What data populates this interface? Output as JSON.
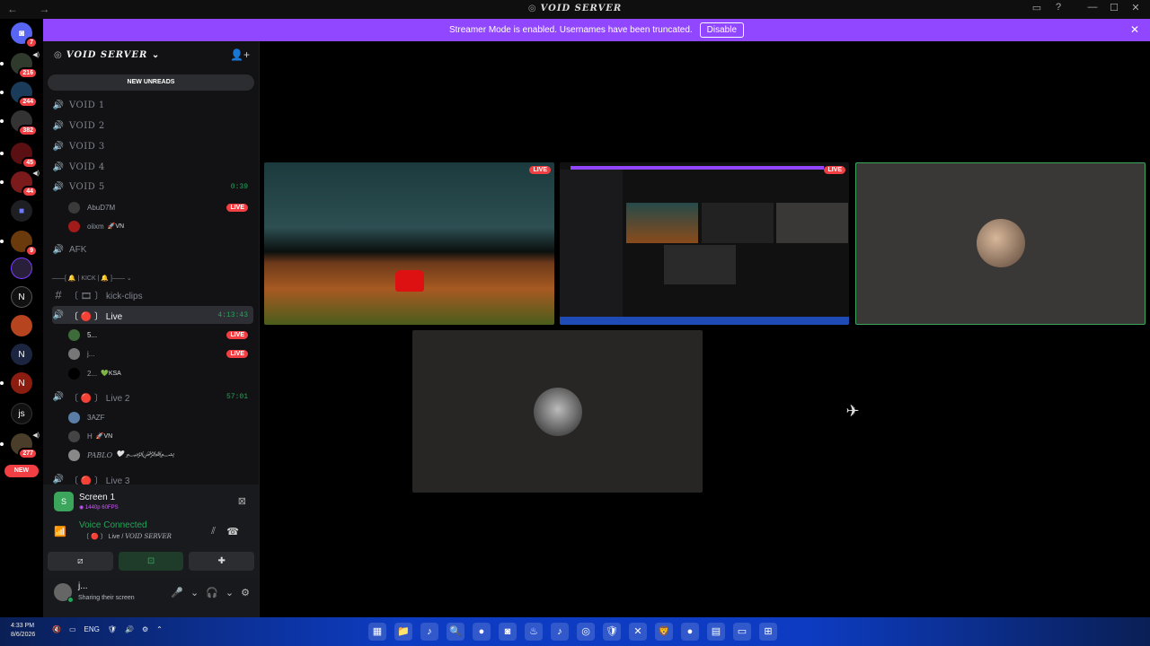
{
  "window": {
    "nav_label": "← →",
    "title": "VOID SERVER",
    "title_icon": "◎",
    "controls": [
      "▭",
      "?",
      "",
      "—",
      "☐",
      "✕"
    ]
  },
  "banner": {
    "text": "Streamer Mode is enabled. Usernames have been truncated.",
    "disable_label": "Disable",
    "close_label": "✕",
    "color": "#9146ff"
  },
  "guilds": [
    {
      "label": "◙",
      "badge": "7"
    },
    {
      "label": "•",
      "badge": "216",
      "vol": "◀)"
    },
    {
      "label": "•",
      "badge": "244"
    },
    {
      "label": "•",
      "badge": "382"
    },
    {
      "label": "•",
      "badge": "45"
    },
    {
      "label": "•",
      "badge": "44",
      "vol": "◀)"
    },
    {
      "label": "■",
      "badge": ""
    },
    {
      "label": "•",
      "badge": "9"
    },
    {
      "label": "•",
      "badge": ""
    },
    {
      "label": "N",
      "badge": ""
    },
    {
      "label": "•",
      "badge": ""
    },
    {
      "label": "N",
      "badge": ""
    },
    {
      "label": "N",
      "badge": ""
    },
    {
      "label": "js",
      "badge": ""
    },
    {
      "label": "•",
      "badge": "277",
      "vol": "◀)"
    }
  ],
  "new_pill": "NEW",
  "server": {
    "name": "VOID SERVER",
    "icon": "◎",
    "chevron": "⌄",
    "add_people_icon": "👤+"
  },
  "new_unreads": "NEW UNREADS",
  "channels": [
    {
      "name": "VOID 1",
      "icon": "🔊",
      "serif": true
    },
    {
      "name": "VOID 2",
      "icon": "🔊",
      "serif": true
    },
    {
      "name": "VOID 3",
      "icon": "🔊",
      "serif": true
    },
    {
      "name": "VOID 4",
      "icon": "🔊",
      "serif": true
    },
    {
      "name": "VOID 5",
      "icon": "🔊",
      "serif": true,
      "time": "0:39",
      "green": true
    }
  ],
  "void5_users": [
    {
      "name": "AbuD7M",
      "live": "LIVE"
    },
    {
      "name": "oiixm",
      "tag": "🚀VN"
    }
  ],
  "afk": "AFK",
  "category": "——[ 🔔 | KICK | 🔔 ]—— ⌄",
  "kick_clips": {
    "icon": "#",
    "name": "〔 🎞 〕 kick-clips"
  },
  "live_channel": {
    "icon": "🔊",
    "name": "〔 🔴 〕 Live",
    "time": "4:13:43"
  },
  "live_users": [
    {
      "name": "5...",
      "live": "LIVE"
    },
    {
      "name": "j...",
      "live": "LIVE"
    },
    {
      "name": "2...",
      "tag": "💚KSA"
    }
  ],
  "live2_channel": {
    "icon": "🔊",
    "name": "〔 🔴 〕 Live 2",
    "time": "57:01"
  },
  "live2_users": [
    {
      "name": "3AZF"
    },
    {
      "name": "H",
      "tag": "🚀VN"
    },
    {
      "name": "PABLO",
      "tag": "🤍 ﷽"
    }
  ],
  "live3_channel": {
    "icon": "🔊",
    "name": "〔 🔴 〕 Live 3"
  },
  "panel": {
    "screen_title": "Screen 1",
    "screen_quality": "◉ 1440p 60FPS",
    "screen_icon": "S",
    "close_icon": "⊠",
    "voice_status": "Voice Connected",
    "voice_channel": "〔 🔴 〕 Live / ",
    "voice_server": "VOID SERVER",
    "signal_icon": "📶",
    "noise_icon": "⫽",
    "hangup_icon": "☎",
    "btn_video": "⧄",
    "btn_screen": "⊡",
    "btn_activity": "✚",
    "user_name": "j...",
    "user_status": "Sharing their screen",
    "user_controls": [
      "🎤",
      "⌄",
      "🎧",
      "⌄",
      "⚙"
    ]
  },
  "stage": {
    "live_label": "LIVE"
  },
  "taskbar": {
    "time": "4:33 PM",
    "date": "8/6/2026",
    "lang": "ENG",
    "tray": [
      "🔇",
      "▭",
      "ENG",
      "🛡",
      "🔊",
      "⚙",
      "⌃"
    ],
    "apps": [
      "▦",
      "📁",
      "♪",
      "🔍",
      "●",
      "◙",
      "♨",
      "♪",
      "◎",
      "🛡",
      "✕",
      "🦁",
      "●",
      "▤",
      "▭",
      "⊞"
    ]
  }
}
